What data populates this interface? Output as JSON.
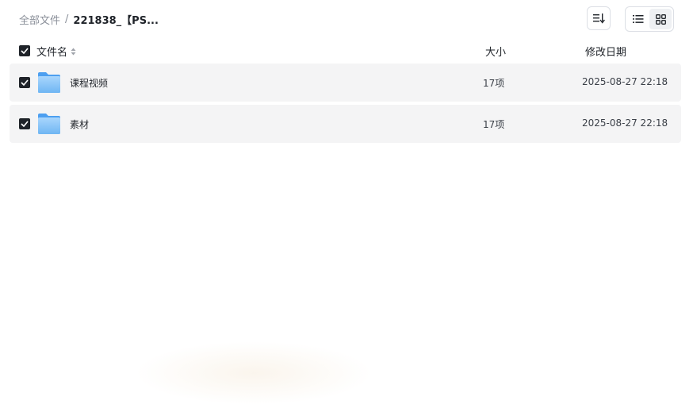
{
  "breadcrumb": {
    "root": "全部文件",
    "separator": "/",
    "current": "221838_【PS..."
  },
  "toolbar": {
    "sort_icon": "sort-icon",
    "list_view_icon": "list-view-icon",
    "grid_view_icon": "grid-view-icon"
  },
  "columns": {
    "name": "文件名",
    "size": "大小",
    "date": "修改日期"
  },
  "files": [
    {
      "name": "课程视频",
      "count": "17项",
      "modified": "2025-08-27 22:18",
      "icon": "folder-icon",
      "checked": true
    },
    {
      "name": "素材",
      "count": "17项",
      "modified": "2025-08-27 22:18",
      "icon": "folder-icon",
      "checked": true
    }
  ],
  "colors": {
    "row_bg": "#f4f4f5",
    "checkbox": "#1f2329",
    "folder": "#6fb6f3"
  }
}
